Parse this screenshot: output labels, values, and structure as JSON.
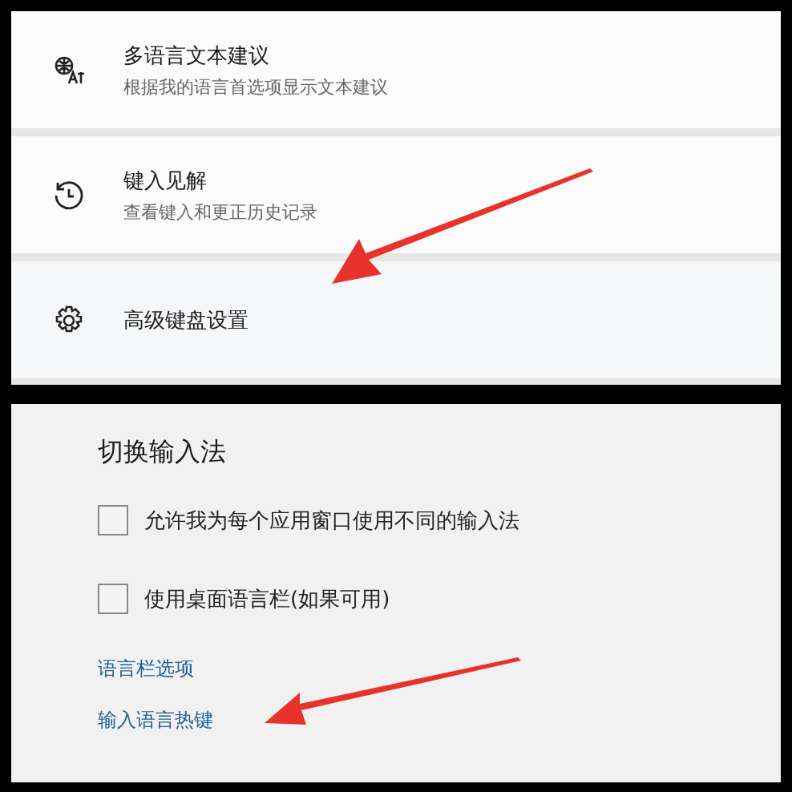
{
  "settings_items": [
    {
      "title": "多语言文本建议",
      "subtitle": "根据我的语言首选项显示文本建议"
    },
    {
      "title": "键入见解",
      "subtitle": "查看键入和更正历史记录"
    },
    {
      "title": "高级键盘设置"
    }
  ],
  "switch_input": {
    "heading": "切换输入法",
    "checkboxes": [
      {
        "label": "允许我为每个应用窗口使用不同的输入法",
        "checked": false
      },
      {
        "label": "使用桌面语言栏(如果可用)",
        "checked": false
      }
    ],
    "links": [
      "语言栏选项",
      "输入语言热键"
    ]
  }
}
